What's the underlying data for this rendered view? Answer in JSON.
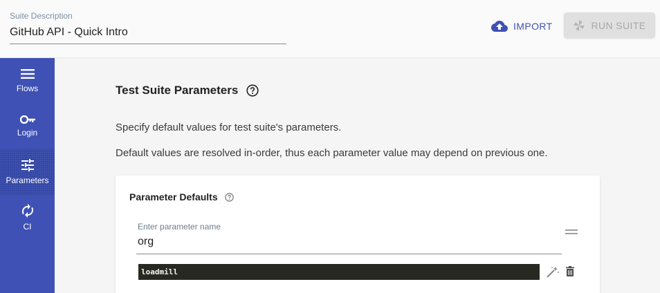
{
  "header": {
    "suite_description_label": "Suite Description",
    "suite_description_value": "GitHub API - Quick Intro",
    "import_label": "IMPORT",
    "run_suite_label": "RUN SUITE"
  },
  "sidebar": {
    "items": [
      {
        "label": "Flows",
        "icon": "menu-icon",
        "active": false
      },
      {
        "label": "Login",
        "icon": "key-icon",
        "active": false
      },
      {
        "label": "Parameters",
        "icon": "tune-icon",
        "active": true
      },
      {
        "label": "CI",
        "icon": "sync-icon",
        "active": false
      }
    ]
  },
  "main": {
    "title": "Test Suite Parameters",
    "description_1": "Specify default values for test suite's parameters.",
    "description_2": "Default values are resolved in-order, thus each parameter value may depend on previous one.",
    "card": {
      "title": "Parameter Defaults",
      "parameter": {
        "name_placeholder": "Enter parameter name",
        "name_value": "org",
        "default_value": "loadmill"
      }
    }
  },
  "colors": {
    "primary": "#3f51b5",
    "code_bg": "#272822"
  }
}
